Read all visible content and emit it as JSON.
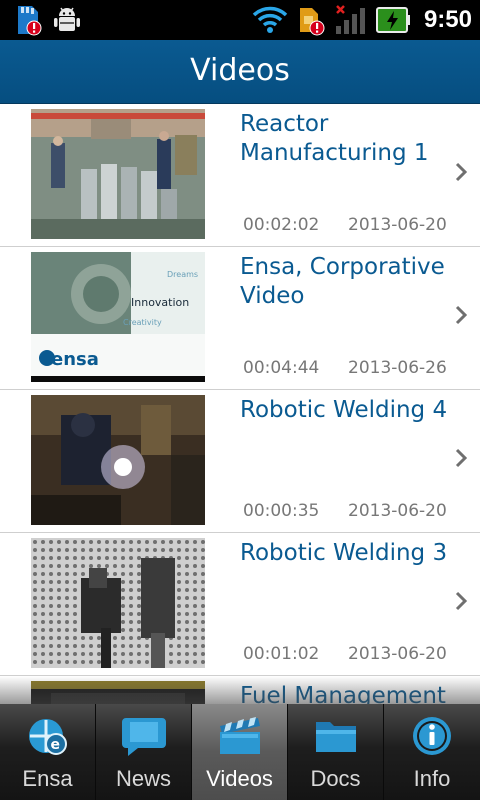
{
  "status_bar": {
    "time": "9:50",
    "icons": [
      "sd-card-alert-icon",
      "android-debug-icon",
      "wifi-icon",
      "sim-alert-icon",
      "signal-no-service-icon",
      "battery-charging-icon"
    ]
  },
  "header": {
    "title": "Videos"
  },
  "videos": [
    {
      "title": "Reactor Manufacturing 1",
      "duration": "00:02:02",
      "date": "2013-06-20"
    },
    {
      "title": "Ensa, Corporative Video",
      "duration": "00:04:44",
      "date": "2013-06-26"
    },
    {
      "title": "Robotic Welding 4",
      "duration": "00:00:35",
      "date": "2013-06-20"
    },
    {
      "title": "Robotic Welding 3",
      "duration": "00:01:02",
      "date": "2013-06-20"
    },
    {
      "title": "Fuel Management",
      "duration": "",
      "date": ""
    }
  ],
  "thumb_text": {
    "word1": "Dreams",
    "word2": "Innovation",
    "word3": "Creativity",
    "logo": "ensa"
  },
  "tabs": [
    {
      "label": "Ensa",
      "icon": "ensa-logo-icon",
      "active": false
    },
    {
      "label": "News",
      "icon": "speech-bubble-icon",
      "active": false
    },
    {
      "label": "Videos",
      "icon": "clapperboard-icon",
      "active": true
    },
    {
      "label": "Docs",
      "icon": "folder-icon",
      "active": false
    },
    {
      "label": "Info",
      "icon": "info-icon",
      "active": false
    }
  ],
  "colors": {
    "header": "#0a5a91",
    "title_text": "#0a5a91",
    "meta_text": "#777777",
    "tab_bar": "#1e1e1e"
  }
}
